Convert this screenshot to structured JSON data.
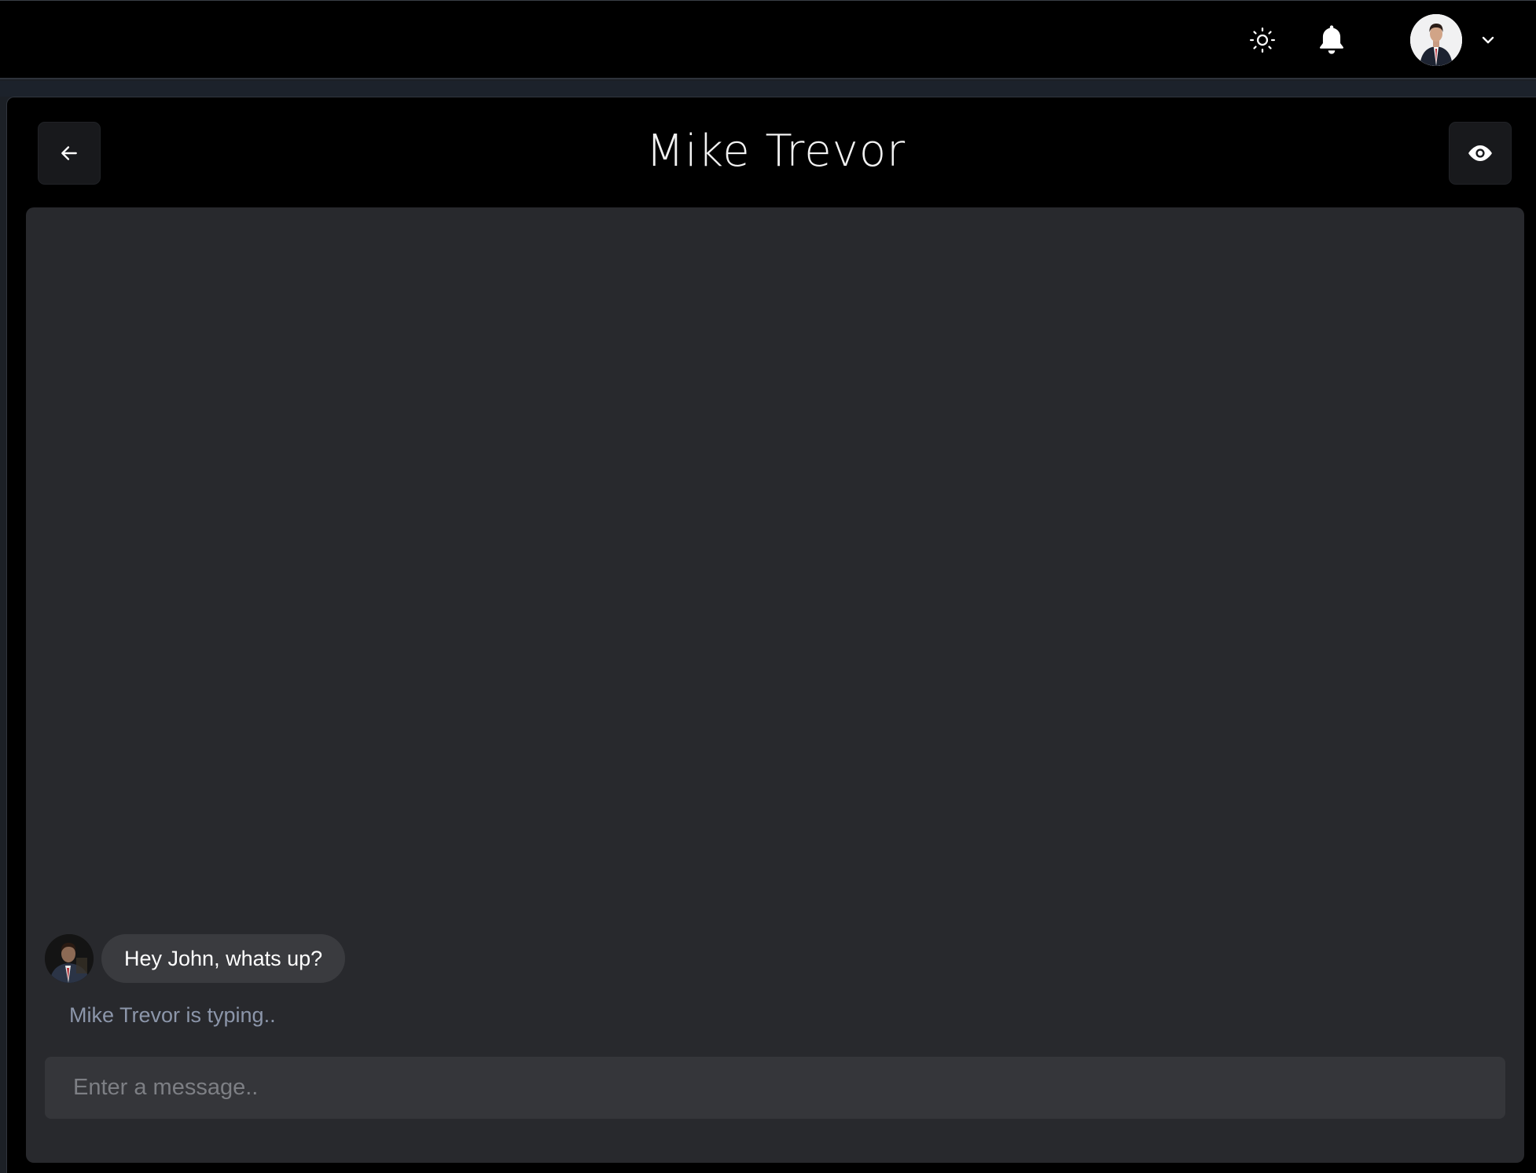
{
  "navbar": {
    "theme_toggle_icon": "sun-icon",
    "notifications_icon": "bell-icon",
    "profile_avatar": "user-avatar",
    "profile_menu_icon": "chevron-down-icon"
  },
  "chat": {
    "title": "Mike Trevor",
    "back_icon": "arrow-left-icon",
    "view_profile_icon": "eye-icon",
    "messages": [
      {
        "sender": "Mike Trevor",
        "text": "Hey John, whats up?"
      }
    ],
    "typing_indicator": "Mike Trevor is typing..",
    "input": {
      "placeholder": "Enter a message..",
      "value": ""
    }
  },
  "colors": {
    "background": "#000000",
    "chat_area": "#28292d",
    "bubble": "#3a3b3f",
    "input": "#35363a",
    "typing_text": "#8c96aa"
  }
}
